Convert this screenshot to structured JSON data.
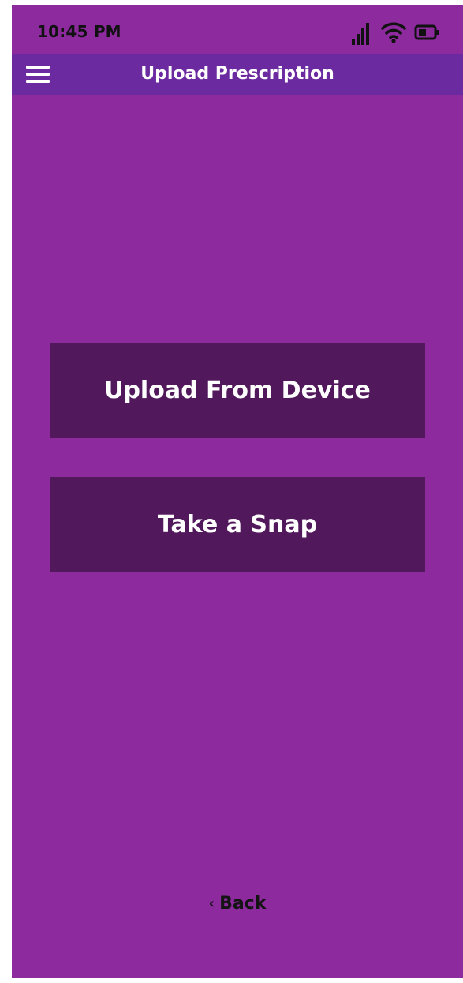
{
  "status_bar": {
    "time": "10:45 PM",
    "icons": [
      "signal-icon",
      "wifi-icon",
      "battery-icon"
    ]
  },
  "app_bar": {
    "menu_icon": "hamburger-menu-icon",
    "title": "Upload Prescription"
  },
  "actions": {
    "upload_label": "Upload From Device",
    "snap_label": "Take a Snap"
  },
  "footer": {
    "back_icon": "chevron-left-icon",
    "back_label": "Back"
  },
  "colors": {
    "background": "#8c2a9e",
    "app_bar": "#6b2aa0",
    "button": "#52185c",
    "button_text": "#ffffff",
    "back_text": "#141414"
  }
}
